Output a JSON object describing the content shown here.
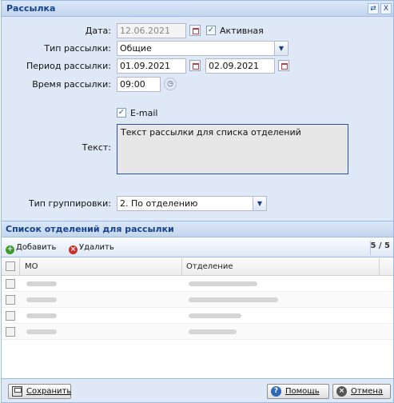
{
  "window": {
    "title": "Рассылка",
    "tools": {
      "restore_icon": "⇄",
      "close_icon": "X"
    }
  },
  "form": {
    "date": {
      "label": "Дата:",
      "value": "12.06.2021"
    },
    "active": {
      "label": "Активная",
      "checked": true
    },
    "type": {
      "label": "Тип рассылки:",
      "value": "Общие"
    },
    "period": {
      "label": "Период рассылки:",
      "from": "01.09.2021",
      "to": "02.09.2021"
    },
    "time": {
      "label": "Время рассылки:",
      "value": "09:00"
    },
    "email": {
      "label": "E-mail",
      "checked": true
    },
    "text": {
      "label": "Текст:",
      "value": "Текст рассылки для списка отделений"
    },
    "grouping": {
      "label": "Тип группировки:",
      "value": "2. По отделению"
    }
  },
  "departments": {
    "title": "Список отделений для рассылки",
    "toolbar": {
      "add_label": "Добавить",
      "delete_label": "Удалить",
      "pager": "5 / 5"
    },
    "columns": [
      "МО",
      "Отделение"
    ],
    "rows_count_visible": 4
  },
  "footer": {
    "save_label": "Сохранить",
    "help_label": "Помощь",
    "cancel_label": "Отмена"
  },
  "colors": {
    "accent": "#15428b",
    "frame": "#99bbe8",
    "background": "#dfe8f6"
  }
}
